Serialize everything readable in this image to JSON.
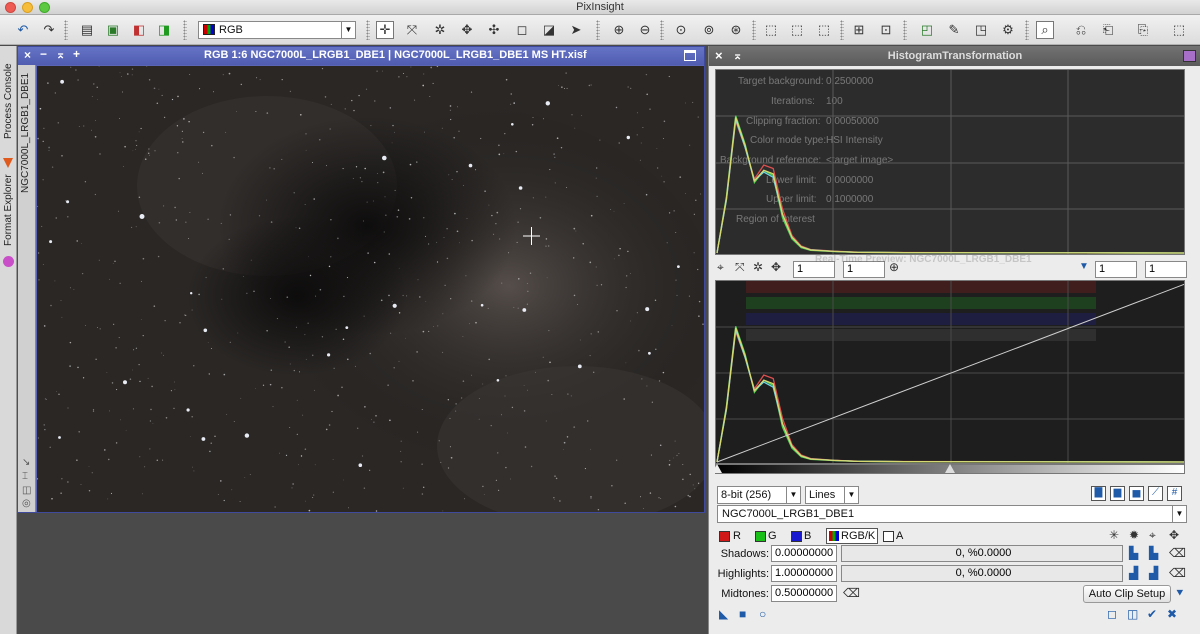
{
  "app": {
    "title": "PixInsight"
  },
  "toolbar": {
    "color_mode": "RGB"
  },
  "left_tabs": [
    "Process Console",
    "Format Explorer"
  ],
  "image_window": {
    "title": "RGB 1:6 NGC7000L_LRGB1_DBE1 | NGC7000L_LRGB1_DBE1   MS   HT.xisf",
    "view_id": "NGC7000L_LRGB1_DBE1",
    "controls": [
      "×",
      "−",
      "⌅",
      "+"
    ]
  },
  "ht": {
    "title": "HistogramTransformation",
    "zoom_h": "1",
    "zoom_v": "1",
    "zoom_h2": "1",
    "zoom_v2": "1",
    "ghost": {
      "target_background_label": "Target background:",
      "target_background": "0.2500000",
      "iterations_label": "Iterations:",
      "iterations": "100",
      "clipping_label": "Clipping fraction:",
      "clipping": "0.00050000",
      "color_mode_label": "Color mode type:",
      "color_mode": "HSI Intensity",
      "background_label": "Background reference:",
      "background": "<target image>",
      "lower_label": "Lower limit:",
      "lower": "0.0000000",
      "upper_label": "Upper limit:",
      "upper": "0.1000000",
      "roi_label": "Region of Interest",
      "preview_title": "Real-Time Preview: NGC7000L_LRGB1_DBE1"
    },
    "resolution": "8-bit (256)",
    "graph_style": "Lines",
    "view_select": "NGC7000L_LRGB1_DBE1",
    "channels": [
      {
        "label": "R",
        "color": "#d01818"
      },
      {
        "label": "G",
        "color": "#18c018"
      },
      {
        "label": "B",
        "color": "#1818d0"
      },
      {
        "label": "RGB/K",
        "color": "#777777"
      },
      {
        "label": "A",
        "color": "#ffffff"
      }
    ],
    "shadows_label": "Shadows:",
    "shadows": "0.00000000",
    "shadows_clip": "0, %0.0000",
    "highlights_label": "Highlights:",
    "highlights": "1.00000000",
    "highlights_clip": "0, %0.0000",
    "midtones_label": "Midtones:",
    "midtones": "0.50000000",
    "auto_clip": "Auto Clip Setup"
  },
  "chart_data": {
    "type": "line",
    "title": "",
    "xlabel": "",
    "ylabel": "",
    "xlim": [
      0,
      1
    ],
    "series": [
      {
        "color": "#e05050",
        "x": [
          0,
          0.02,
          0.04,
          0.06,
          0.08,
          0.1,
          0.12,
          0.14,
          0.16,
          0.18,
          0.2,
          0.25,
          0.3,
          0.4,
          1.0
        ],
        "y": [
          0,
          0.3,
          0.75,
          0.6,
          0.42,
          0.5,
          0.48,
          0.25,
          0.1,
          0.04,
          0.02,
          0.01,
          0.005,
          0.003,
          0.0
        ]
      },
      {
        "color": "#50d050",
        "x": [
          0,
          0.02,
          0.04,
          0.06,
          0.08,
          0.1,
          0.12,
          0.14,
          0.16,
          0.18,
          0.2,
          0.25,
          0.3,
          0.4,
          1.0
        ],
        "y": [
          0,
          0.32,
          0.78,
          0.62,
          0.4,
          0.47,
          0.44,
          0.2,
          0.08,
          0.03,
          0.015,
          0.008,
          0.004,
          0.002,
          0.0
        ]
      },
      {
        "color": "#6bd5e6",
        "x": [
          0,
          0.02,
          0.04,
          0.06,
          0.08,
          0.1,
          0.12,
          0.14,
          0.16,
          0.18,
          0.2,
          0.25,
          0.3,
          0.4,
          1.0
        ],
        "y": [
          0,
          0.3,
          0.76,
          0.6,
          0.41,
          0.46,
          0.43,
          0.22,
          0.09,
          0.035,
          0.018,
          0.009,
          0.004,
          0.002,
          0.0
        ]
      },
      {
        "color": "#d8d870",
        "x": [
          0,
          0.02,
          0.04,
          0.06,
          0.08,
          0.1,
          0.12,
          0.14,
          0.16,
          0.18,
          0.2,
          0.25,
          0.3,
          0.4,
          1.0
        ],
        "y": [
          0,
          0.31,
          0.77,
          0.61,
          0.41,
          0.47,
          0.45,
          0.22,
          0.09,
          0.035,
          0.017,
          0.009,
          0.004,
          0.002,
          0.0
        ]
      }
    ],
    "transfer_curve": {
      "x": [
        0,
        1
      ],
      "y": [
        0,
        1
      ]
    }
  }
}
